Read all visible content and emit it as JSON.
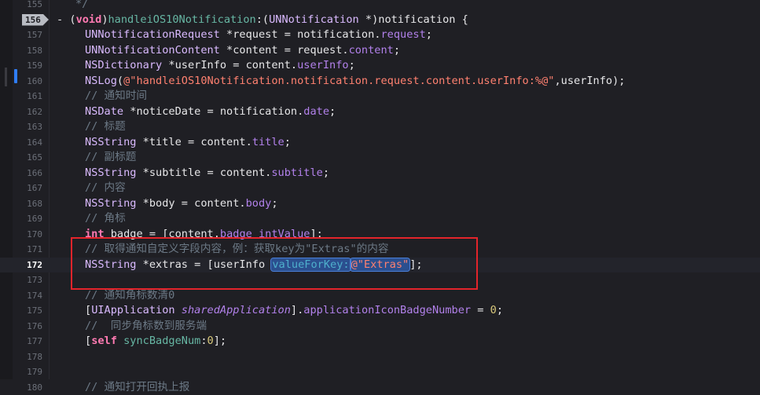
{
  "editor": {
    "lines": [
      {
        "num": "155",
        "indent": 1,
        "tokens": [
          {
            "t": "*/",
            "c": "cmt"
          }
        ]
      },
      {
        "num": "156",
        "indent": 0,
        "breakpoint": true,
        "tokens": [
          {
            "t": "- (",
            "c": ""
          },
          {
            "t": "void",
            "c": "kw"
          },
          {
            "t": ")",
            "c": ""
          },
          {
            "t": "handleiOS10Notification",
            "c": "fn"
          },
          {
            "t": ":(",
            "c": ""
          },
          {
            "t": "UNNotification",
            "c": "cls"
          },
          {
            "t": " *)notification {",
            "c": ""
          }
        ]
      },
      {
        "num": "157",
        "indent": 2,
        "tokens": [
          {
            "t": "UNNotificationRequest",
            "c": "cls"
          },
          {
            "t": " *request = notification.",
            "c": ""
          },
          {
            "t": "request",
            "c": "prop"
          },
          {
            "t": ";",
            "c": ""
          }
        ]
      },
      {
        "num": "158",
        "indent": 2,
        "tokens": [
          {
            "t": "UNNotificationContent",
            "c": "cls"
          },
          {
            "t": " *content = request.",
            "c": ""
          },
          {
            "t": "content",
            "c": "prop"
          },
          {
            "t": ";",
            "c": ""
          }
        ]
      },
      {
        "num": "159",
        "indent": 2,
        "tokens": [
          {
            "t": "NSDictionary",
            "c": "cls"
          },
          {
            "t": " *userInfo = content.",
            "c": ""
          },
          {
            "t": "userInfo",
            "c": "prop"
          },
          {
            "t": ";",
            "c": ""
          }
        ]
      },
      {
        "num": "160",
        "indent": 2,
        "changed": true,
        "tokens": [
          {
            "t": "NSLog",
            "c": "cls"
          },
          {
            "t": "(",
            "c": ""
          },
          {
            "t": "@\"handleiOS10Notification.notification.request.content.userInfo:%@\"",
            "c": "str"
          },
          {
            "t": ",userInfo);",
            "c": ""
          }
        ]
      },
      {
        "num": "161",
        "indent": 2,
        "tokens": [
          {
            "t": "// 通知时间",
            "c": "cmt"
          }
        ]
      },
      {
        "num": "162",
        "indent": 2,
        "tokens": [
          {
            "t": "NSDate",
            "c": "cls"
          },
          {
            "t": " *noticeDate = notification.",
            "c": ""
          },
          {
            "t": "date",
            "c": "prop"
          },
          {
            "t": ";",
            "c": ""
          }
        ]
      },
      {
        "num": "163",
        "indent": 2,
        "tokens": [
          {
            "t": "// 标题",
            "c": "cmt"
          }
        ]
      },
      {
        "num": "164",
        "indent": 2,
        "tokens": [
          {
            "t": "NSString",
            "c": "cls"
          },
          {
            "t": " *title = content.",
            "c": ""
          },
          {
            "t": "title",
            "c": "prop"
          },
          {
            "t": ";",
            "c": ""
          }
        ]
      },
      {
        "num": "165",
        "indent": 2,
        "tokens": [
          {
            "t": "// 副标题",
            "c": "cmt"
          }
        ]
      },
      {
        "num": "166",
        "indent": 2,
        "tokens": [
          {
            "t": "NSString",
            "c": "cls"
          },
          {
            "t": " *subtitle = content.",
            "c": ""
          },
          {
            "t": "subtitle",
            "c": "prop"
          },
          {
            "t": ";",
            "c": ""
          }
        ]
      },
      {
        "num": "167",
        "indent": 2,
        "tokens": [
          {
            "t": "// 内容",
            "c": "cmt"
          }
        ]
      },
      {
        "num": "168",
        "indent": 2,
        "tokens": [
          {
            "t": "NSString",
            "c": "cls"
          },
          {
            "t": " *body = content.",
            "c": ""
          },
          {
            "t": "body",
            "c": "prop"
          },
          {
            "t": ";",
            "c": ""
          }
        ]
      },
      {
        "num": "169",
        "indent": 2,
        "tokens": [
          {
            "t": "// 角标",
            "c": "cmt"
          }
        ]
      },
      {
        "num": "170",
        "indent": 2,
        "tokens": [
          {
            "t": "int",
            "c": "kw"
          },
          {
            "t": " badge = [content.",
            "c": ""
          },
          {
            "t": "badge",
            "c": "prop"
          },
          {
            "t": " ",
            "c": ""
          },
          {
            "t": "intValue",
            "c": "prop"
          },
          {
            "t": "];",
            "c": ""
          }
        ]
      },
      {
        "num": "171",
        "indent": 2,
        "tokens": [
          {
            "t": "// 取得通知自定义字段内容，例：获取key为\"Extras\"的内容",
            "c": "cmt"
          }
        ]
      },
      {
        "num": "172",
        "indent": 2,
        "current": true,
        "tokens": [
          {
            "t": "NSString",
            "c": "cls"
          },
          {
            "t": " *extras = [userInfo ",
            "c": ""
          },
          {
            "t": "valueForKey:",
            "c": "meth",
            "sel": true
          },
          {
            "t": "@\"Extras\"",
            "c": "str",
            "sel": true
          },
          {
            "t": "];",
            "c": ""
          }
        ]
      },
      {
        "num": "173",
        "indent": 2,
        "tokens": []
      },
      {
        "num": "174",
        "indent": 2,
        "tokens": [
          {
            "t": "// 通知角标数清0",
            "c": "cmt"
          }
        ]
      },
      {
        "num": "175",
        "indent": 2,
        "tokens": [
          {
            "t": "[",
            "c": ""
          },
          {
            "t": "UIApplication",
            "c": "cls"
          },
          {
            "t": " ",
            "c": ""
          },
          {
            "t": "sharedApplication",
            "c": "prj"
          },
          {
            "t": "].",
            "c": ""
          },
          {
            "t": "applicationIconBadgeNumber",
            "c": "prop"
          },
          {
            "t": " = ",
            "c": ""
          },
          {
            "t": "0",
            "c": "num"
          },
          {
            "t": ";",
            "c": ""
          }
        ]
      },
      {
        "num": "176",
        "indent": 2,
        "tokens": [
          {
            "t": "//  同步角标数到服务端",
            "c": "cmt"
          }
        ]
      },
      {
        "num": "177",
        "indent": 2,
        "tokens": [
          {
            "t": "[",
            "c": ""
          },
          {
            "t": "self",
            "c": "kw"
          },
          {
            "t": " ",
            "c": ""
          },
          {
            "t": "syncBadgeNum",
            "c": "fn"
          },
          {
            "t": ":",
            "c": ""
          },
          {
            "t": "0",
            "c": "num"
          },
          {
            "t": "];",
            "c": ""
          }
        ]
      },
      {
        "num": "178",
        "indent": 2,
        "tokens": []
      },
      {
        "num": "179",
        "indent": 2,
        "tokens": []
      },
      {
        "num": "180",
        "indent": 2,
        "tokens": [
          {
            "t": "// 通知打开回执上报",
            "c": "cmt"
          }
        ]
      }
    ]
  },
  "annotation": {
    "color": "#e3242b"
  },
  "colors": {
    "background": "#1f1f24",
    "keyword": "#ff7ab2",
    "class": "#dabaff",
    "property": "#b281eb",
    "string": "#ff8170",
    "number": "#d9c97c",
    "comment": "#6c7986",
    "selection": "#2b4f8f",
    "change_bar": "#2f7df6"
  }
}
